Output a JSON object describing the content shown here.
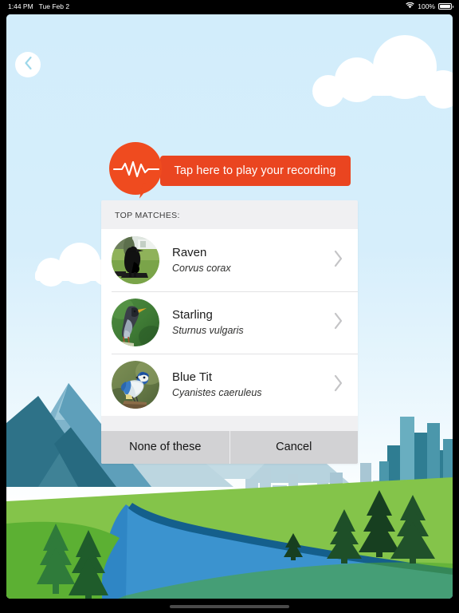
{
  "status_bar": {
    "time": "1:44 PM",
    "date": "Tue Feb 2",
    "battery_percent": "100%",
    "wifi_icon": "wifi-icon",
    "battery_icon": "battery-full-icon"
  },
  "nav": {
    "back_icon": "chevron-left-icon",
    "back_label": ""
  },
  "player": {
    "bubble_icon": "sound-waveform-bubble-icon",
    "play_label": "Tap here to play your recording"
  },
  "matches": {
    "header": "TOP MATCHES:",
    "rows": [
      {
        "name": "Raven",
        "scientific": "Corvus corax",
        "thumb": "raven-photo",
        "chevron": "chevron-right-icon"
      },
      {
        "name": "Starling",
        "scientific": "Sturnus vulgaris",
        "thumb": "starling-photo",
        "chevron": "chevron-right-icon"
      },
      {
        "name": "Blue Tit",
        "scientific": "Cyanistes caeruleus",
        "thumb": "blue-tit-photo",
        "chevron": "chevron-right-icon"
      }
    ],
    "none_label": "None of these",
    "cancel_label": "Cancel"
  },
  "colors": {
    "accent_orange": "#ea4520",
    "bubble_orange": "#ef4b1f",
    "sky_blue": "#d2edfb",
    "card_header_grey": "#f0f0f2",
    "action_grey": "#d2d2d4",
    "back_chevron": "#9ed8ea"
  }
}
